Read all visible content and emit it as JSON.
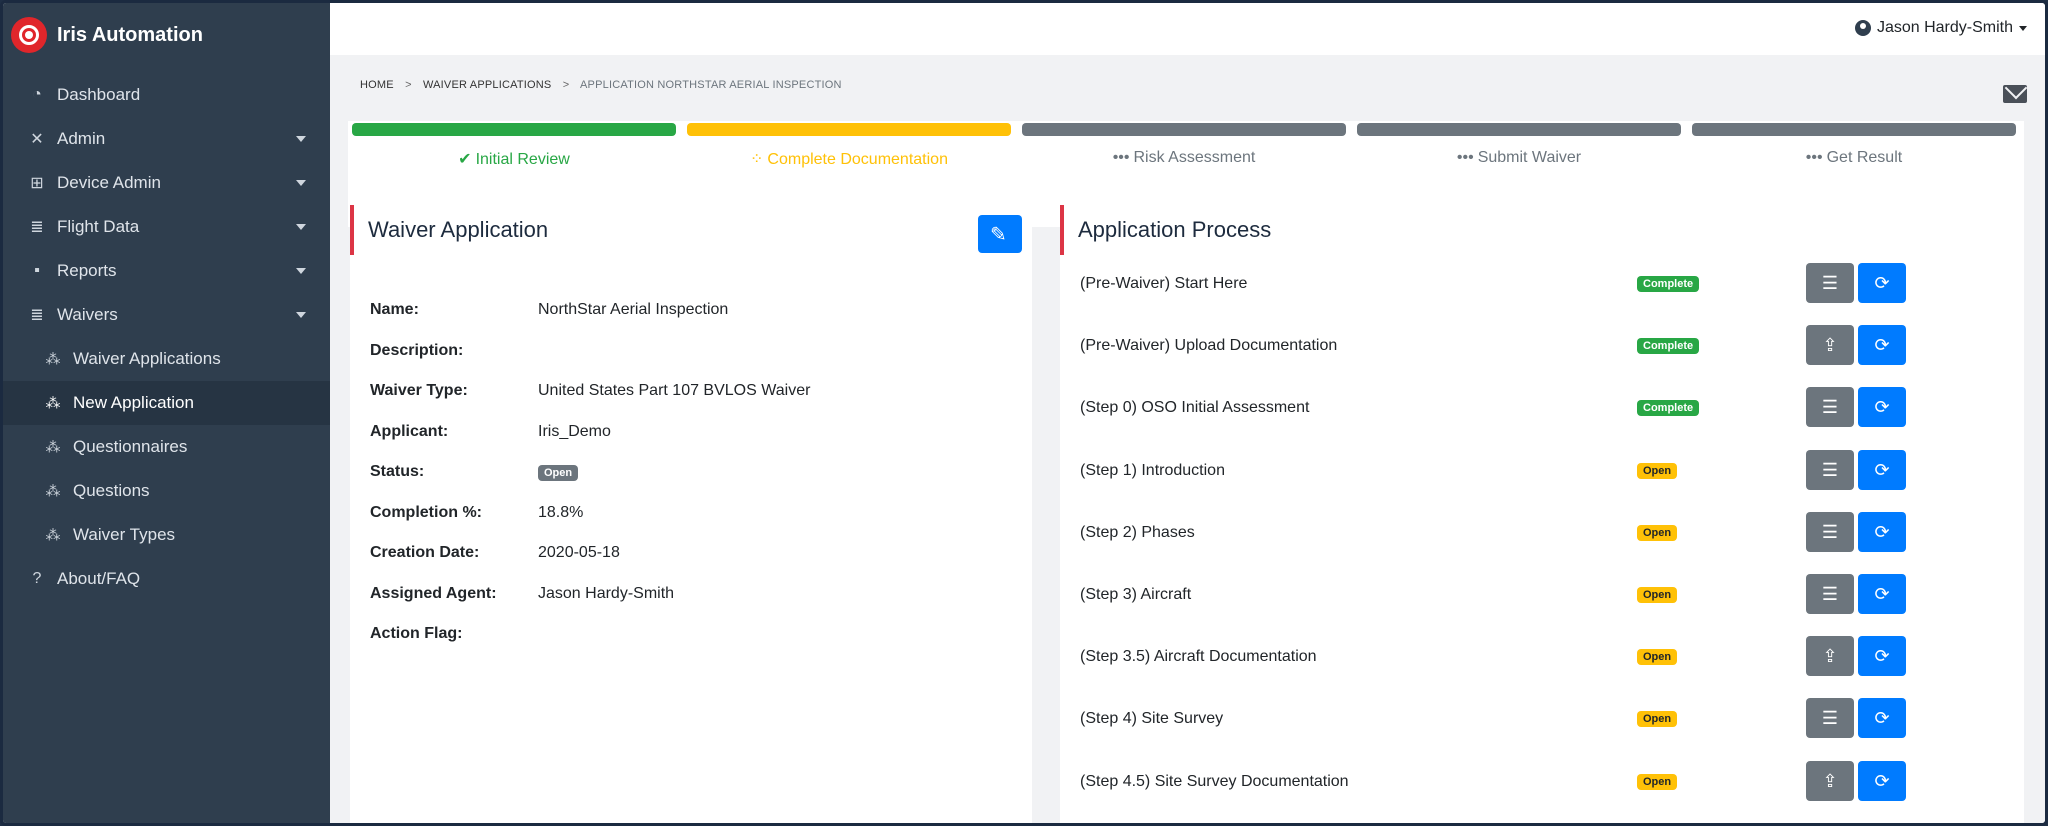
{
  "app": {
    "name": "Iris Automation"
  },
  "sidebar": {
    "items": [
      {
        "label": "Dashboard",
        "icon": "dashboard-icon",
        "glyph": "◔"
      },
      {
        "label": "Admin",
        "icon": "tools-icon",
        "glyph": "✕"
      },
      {
        "label": "Device Admin",
        "icon": "network-icon",
        "glyph": "⊞"
      },
      {
        "label": "Flight Data",
        "icon": "database-icon",
        "glyph": "≣"
      },
      {
        "label": "Reports",
        "icon": "report-icon",
        "glyph": "▪"
      },
      {
        "label": "Waivers",
        "icon": "database-icon",
        "glyph": "≣"
      }
    ],
    "subitems": [
      {
        "label": "Waiver Applications",
        "icon": "satellite-icon",
        "glyph": "⁂"
      },
      {
        "label": "New Application",
        "icon": "satellite-icon",
        "glyph": "⁂"
      },
      {
        "label": "Questionnaires",
        "icon": "satellite-icon",
        "glyph": "⁂"
      },
      {
        "label": "Questions",
        "icon": "satellite-icon",
        "glyph": "⁂"
      },
      {
        "label": "Waiver Types",
        "icon": "satellite-icon",
        "glyph": "⁂"
      }
    ],
    "about": {
      "label": "About/FAQ",
      "icon": "question-icon",
      "glyph": "?"
    }
  },
  "header": {
    "user": "Jason Hardy-Smith"
  },
  "breadcrumb": {
    "home": "HOME",
    "sep": ">",
    "waivers": "WAIVER APPLICATIONS",
    "current": "APPLICATION NORTHSTAR AERIAL INSPECTION"
  },
  "steps": [
    {
      "label": "Initial Review",
      "state": "complete",
      "glyph": "✔"
    },
    {
      "label": "Complete Documentation",
      "state": "in-progress",
      "glyph": "⁘"
    },
    {
      "label": "Risk Assessment",
      "state": "pending",
      "glyph": "•••"
    },
    {
      "label": "Submit Waiver",
      "state": "pending",
      "glyph": "•••"
    },
    {
      "label": "Get Result",
      "state": "pending",
      "glyph": "•••"
    }
  ],
  "waiver": {
    "title": "Waiver Application",
    "fields": [
      {
        "label": "Name:",
        "value": "NorthStar Aerial Inspection"
      },
      {
        "label": "Description:",
        "value": ""
      },
      {
        "label": "Waiver Type:",
        "value": "United States Part 107 BVLOS Waiver"
      },
      {
        "label": "Applicant:",
        "value": "Iris_Demo"
      },
      {
        "label": "Status:",
        "value": "Open",
        "badge": true
      },
      {
        "label": "Completion %:",
        "value": "18.8%"
      },
      {
        "label": "Creation Date:",
        "value": "2020-05-18"
      },
      {
        "label": "Assigned Agent:",
        "value": "Jason Hardy-Smith"
      },
      {
        "label": "Action Flag:",
        "value": ""
      }
    ]
  },
  "process": {
    "title": "Application Process",
    "rows": [
      {
        "name": "(Pre-Waiver) Start Here",
        "status": "Complete",
        "action": "list"
      },
      {
        "name": "(Pre-Waiver) Upload Documentation",
        "status": "Complete",
        "action": "upload"
      },
      {
        "name": "(Step 0) OSO Initial Assessment",
        "status": "Complete",
        "action": "list"
      },
      {
        "name": "(Step 1) Introduction",
        "status": "Open",
        "action": "list"
      },
      {
        "name": "(Step 2) Phases",
        "status": "Open",
        "action": "list"
      },
      {
        "name": "(Step 3) Aircraft",
        "status": "Open",
        "action": "list"
      },
      {
        "name": "(Step 3.5) Aircraft Documentation",
        "status": "Open",
        "action": "upload"
      },
      {
        "name": "(Step 4) Site Survey",
        "status": "Open",
        "action": "list"
      },
      {
        "name": "(Step 4.5) Site Survey Documentation",
        "status": "Open",
        "action": "upload"
      }
    ]
  },
  "colors": {
    "sidebar": "#2f3e4e",
    "accent": "#007bff",
    "success": "#28a745",
    "warning": "#ffc107",
    "muted": "#6c757d",
    "card_accent": "#dc3545"
  }
}
